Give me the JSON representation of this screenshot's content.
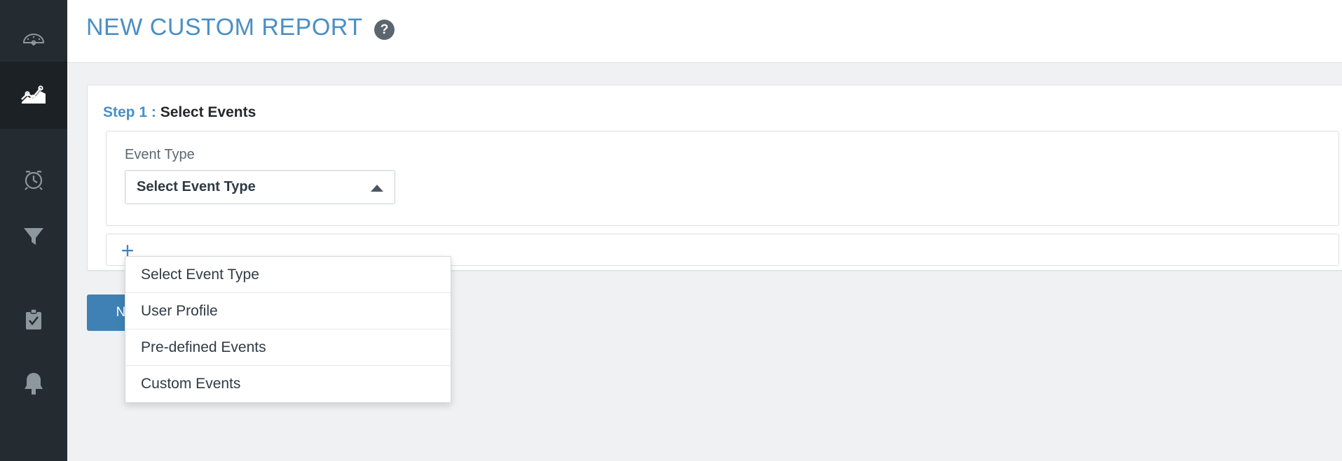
{
  "header": {
    "title": "NEW CUSTOM REPORT",
    "help_label": "?",
    "title_color": "#4a8fc4"
  },
  "sidebar": {
    "background": "#252c31",
    "active_background": "#1b2125",
    "items": [
      {
        "name": "dashboard",
        "icon": "speedometer-icon",
        "active": false
      },
      {
        "name": "analytics",
        "icon": "line-chart-icon",
        "active": true
      },
      {
        "name": "scheduled",
        "icon": "alarm-clock-icon",
        "active": false
      },
      {
        "name": "funnels",
        "icon": "funnel-icon",
        "active": false
      },
      {
        "name": "tasks",
        "icon": "clipboard-check-icon",
        "active": false
      },
      {
        "name": "notifications",
        "icon": "bell-icon",
        "active": false
      }
    ]
  },
  "step": {
    "label": "Step 1 :",
    "title": "Select Events",
    "label_color": "#4a8fc4"
  },
  "event_section": {
    "field_label": "Event Type",
    "select_value": "Select Event Type",
    "caret_icon": "chevron-up-icon",
    "add_button_label": "+"
  },
  "dropdown": {
    "open": true,
    "options": [
      "Select Event Type",
      "User Profile",
      "Pre-defined Events",
      "Custom Events"
    ]
  },
  "actions": {
    "next_label": "Next",
    "next_color": "#3f81b4"
  }
}
